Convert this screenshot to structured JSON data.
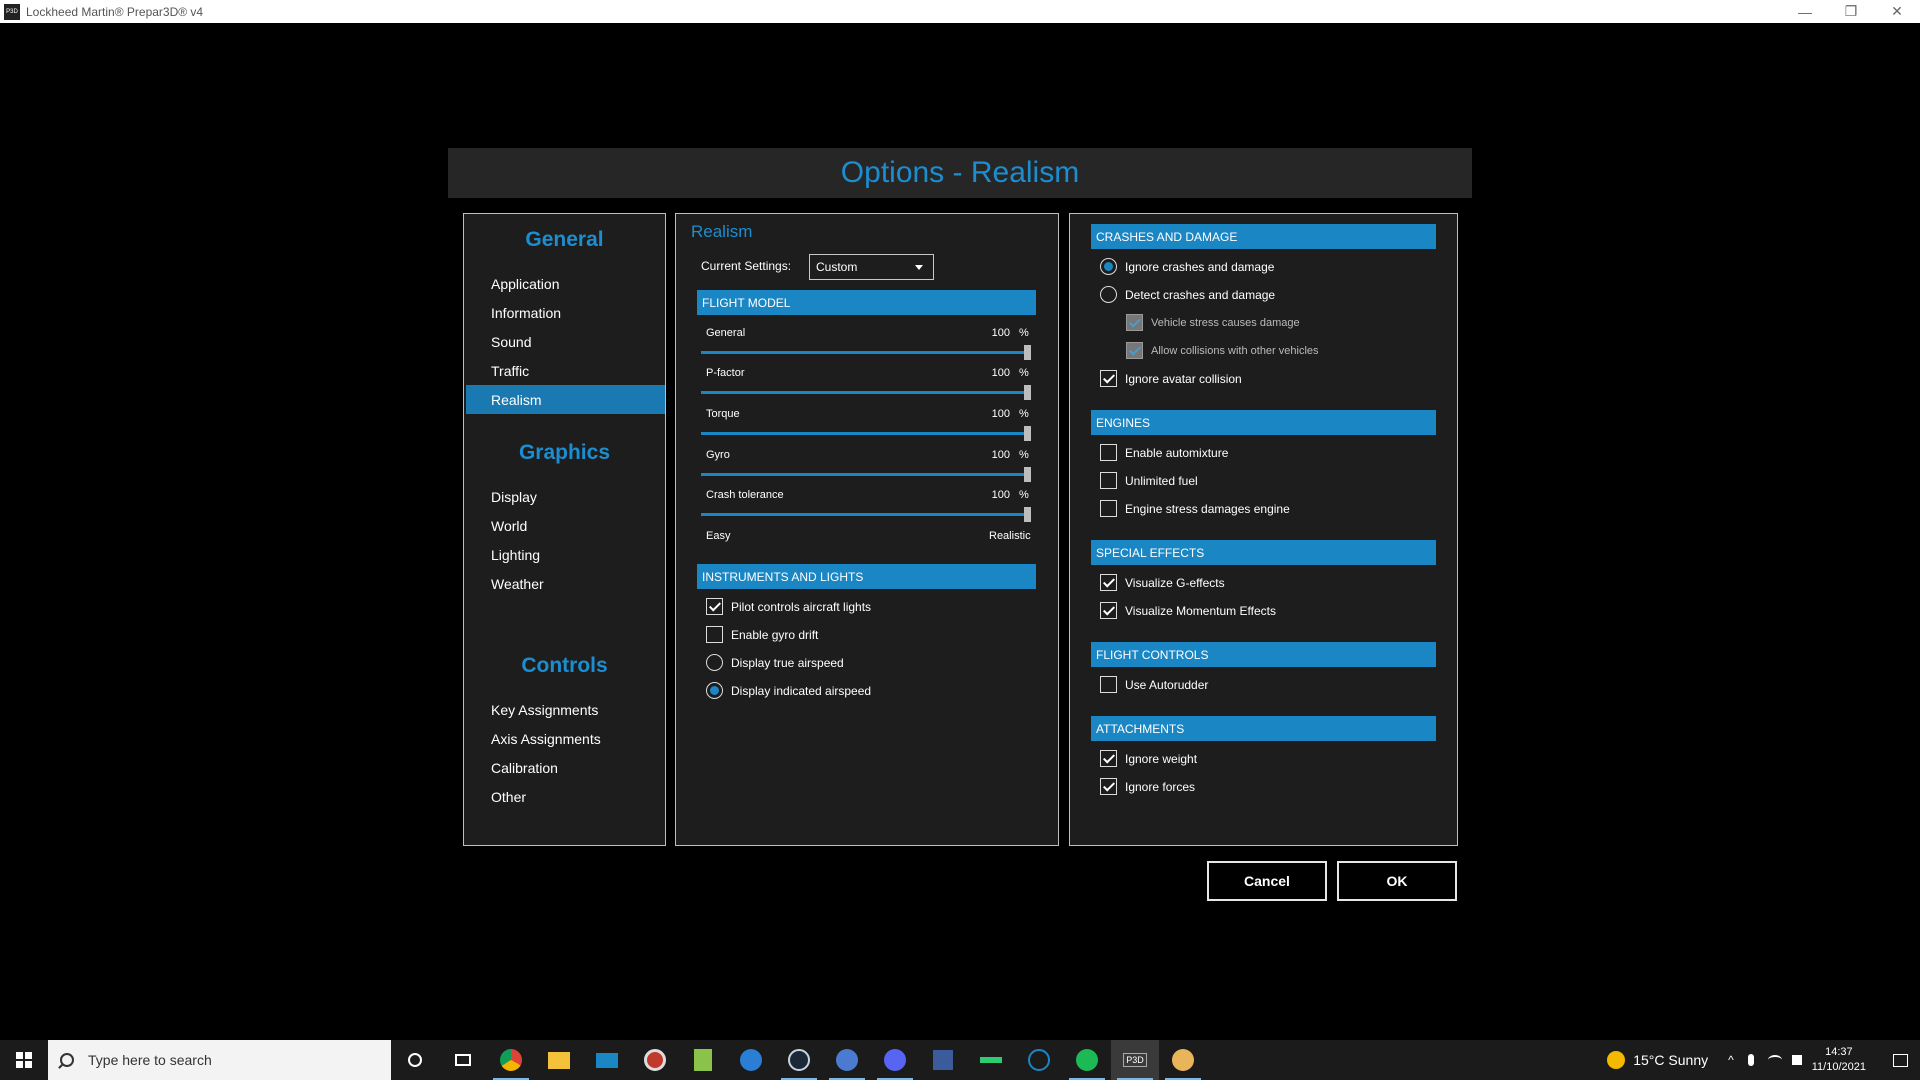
{
  "window": {
    "title": "Lockheed Martin® Prepar3D® v4",
    "icon": "P3D",
    "controls": [
      "—",
      "❐",
      "✕"
    ]
  },
  "dialog": {
    "title": "Options - Realism"
  },
  "nav": {
    "general_heading": "General",
    "general_items": [
      "Application",
      "Information",
      "Sound",
      "Traffic",
      "Realism"
    ],
    "graphics_heading": "Graphics",
    "graphics_items": [
      "Display",
      "World",
      "Lighting",
      "Weather"
    ],
    "controls_heading": "Controls",
    "controls_items": [
      "Key Assignments",
      "Axis Assignments",
      "Calibration",
      "Other"
    ],
    "active": "Realism"
  },
  "realism": {
    "title": "Realism",
    "current_settings_label": "Current Settings:",
    "current_settings_value": "Custom",
    "flight_model_header": "FLIGHT MODEL",
    "sliders": [
      {
        "label": "General",
        "value": "100",
        "unit": "%",
        "fraction": 1.0
      },
      {
        "label": "P-factor",
        "value": "100",
        "unit": "%",
        "fraction": 1.0
      },
      {
        "label": "Torque",
        "value": "100",
        "unit": "%",
        "fraction": 1.0
      },
      {
        "label": "Gyro",
        "value": "100",
        "unit": "%",
        "fraction": 1.0
      },
      {
        "label": "Crash tolerance",
        "value": "100",
        "unit": "%",
        "fraction": 1.0
      }
    ],
    "scale_min": "Easy",
    "scale_max": "Realistic",
    "instruments_header": "INSTRUMENTS AND LIGHTS",
    "instruments": [
      {
        "label": "Pilot controls aircraft lights",
        "type": "checkbox",
        "checked": true
      },
      {
        "label": "Enable gyro drift",
        "type": "checkbox",
        "checked": false
      },
      {
        "label": "Display true airspeed",
        "type": "radio",
        "checked": false
      },
      {
        "label": "Display indicated airspeed",
        "type": "radio",
        "checked": true
      }
    ]
  },
  "right": {
    "crashes_header": "CRASHES AND DAMAGE",
    "crashes": [
      {
        "label": "Ignore crashes and damage",
        "type": "radio",
        "checked": true
      },
      {
        "label": "Detect crashes and damage",
        "type": "radio",
        "checked": false
      },
      {
        "label": "Vehicle stress causes damage",
        "type": "checkbox",
        "checked": true,
        "disabled": true
      },
      {
        "label": "Allow collisions with other vehicles",
        "type": "checkbox",
        "checked": true,
        "disabled": true
      },
      {
        "label": "Ignore avatar collision",
        "type": "checkbox",
        "checked": true
      }
    ],
    "engines_header": "ENGINES",
    "engines": [
      {
        "label": "Enable automixture",
        "checked": false
      },
      {
        "label": "Unlimited fuel",
        "checked": false
      },
      {
        "label": "Engine stress damages engine",
        "checked": false
      }
    ],
    "effects_header": "SPECIAL EFFECTS",
    "effects": [
      {
        "label": "Visualize G-effects",
        "checked": true
      },
      {
        "label": "Visualize Momentum Effects",
        "checked": true
      }
    ],
    "flight_controls_header": "FLIGHT CONTROLS",
    "flight_controls": [
      {
        "label": "Use Autorudder",
        "checked": false
      }
    ],
    "attachments_header": "ATTACHMENTS",
    "attachments": [
      {
        "label": "Ignore weight",
        "checked": true
      },
      {
        "label": "Ignore forces",
        "checked": true
      }
    ]
  },
  "buttons": {
    "cancel": "Cancel",
    "ok": "OK"
  },
  "taskbar": {
    "search_placeholder": "Type here to search",
    "weather": "15°C  Sunny",
    "time": "14:37",
    "date": "11/10/2021",
    "p3d_label": "P3D"
  },
  "colors": {
    "accent": "#1c8ed0",
    "section_bar": "#1b86c4",
    "active_nav": "#1979b0"
  }
}
